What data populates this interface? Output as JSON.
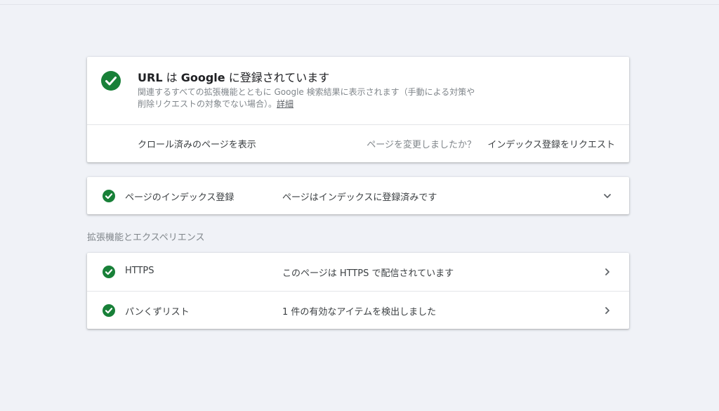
{
  "summary": {
    "title_url": "URL",
    "title_ha": " は ",
    "title_google": "Google",
    "title_rest": " に登録されています",
    "description": "関連するすべての拡張機能とともに Google 検索結果に表示されます（手動による対策や削除リクエストの対象でない場合）。",
    "details_link": "詳細",
    "crawled_page_label": "クロール済みのページを表示",
    "changed_question": "ページを変更しましたか？",
    "request_indexing_label": "インデックス登録をリクエスト",
    "status_icon": "check-circle-icon"
  },
  "index_row": {
    "name": "ページのインデックス登録",
    "status": "ページはインデックスに登録済みです",
    "icon": "check-circle-icon",
    "toggle_icon": "chevron-down-icon"
  },
  "enhancements": {
    "section_title": "拡張機能とエクスペリエンス",
    "items": [
      {
        "name": "HTTPS",
        "status": "このページは HTTPS で配信されています",
        "icon": "check-circle-icon",
        "nav_icon": "chevron-right-icon"
      },
      {
        "name": "パンくずリスト",
        "status": "1 件の有効なアイテムを検出しました",
        "icon": "check-circle-icon",
        "nav_icon": "chevron-right-icon"
      }
    ]
  },
  "colors": {
    "success": "#188038",
    "background": "#f0f2f7",
    "card": "#ffffff"
  }
}
